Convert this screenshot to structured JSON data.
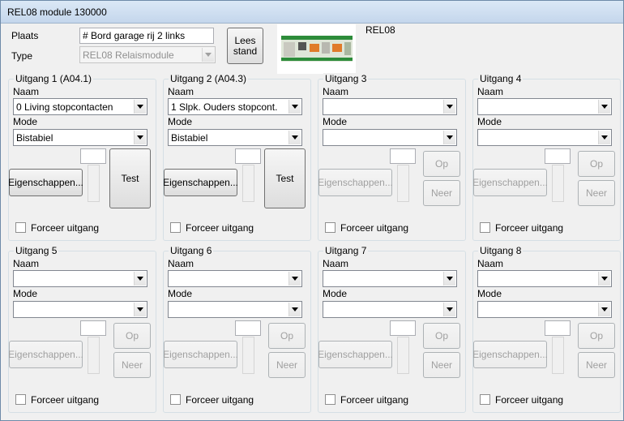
{
  "window": {
    "title": "REL08 module 130000"
  },
  "header": {
    "plaats_label": "Plaats",
    "plaats_value": "# Bord garage rij 2 links",
    "type_label": "Type",
    "type_value": "REL08 Relaismodule",
    "lees_stand_label": "Lees stand",
    "module_name": "REL08"
  },
  "labels": {
    "naam": "Naam",
    "mode": "Mode",
    "eigenschappen": "Eigenschappen...",
    "test": "Test",
    "op": "Op",
    "neer": "Neer",
    "forceer": "Forceer uitgang"
  },
  "outputs": [
    {
      "title": "Uitgang 1 (A04.1)",
      "naam": "0 Living stopcontacten",
      "mode": "Bistabiel"
    },
    {
      "title": "Uitgang 2 (A04.3)",
      "naam": "1 Slpk. Ouders stopcont.",
      "mode": "Bistabiel"
    },
    {
      "title": "Uitgang 3",
      "naam": "",
      "mode": ""
    },
    {
      "title": "Uitgang 4",
      "naam": "",
      "mode": ""
    },
    {
      "title": "Uitgang 5",
      "naam": "",
      "mode": ""
    },
    {
      "title": "Uitgang 6",
      "naam": "",
      "mode": ""
    },
    {
      "title": "Uitgang 7",
      "naam": "",
      "mode": ""
    },
    {
      "title": "Uitgang 8",
      "naam": "",
      "mode": ""
    }
  ]
}
